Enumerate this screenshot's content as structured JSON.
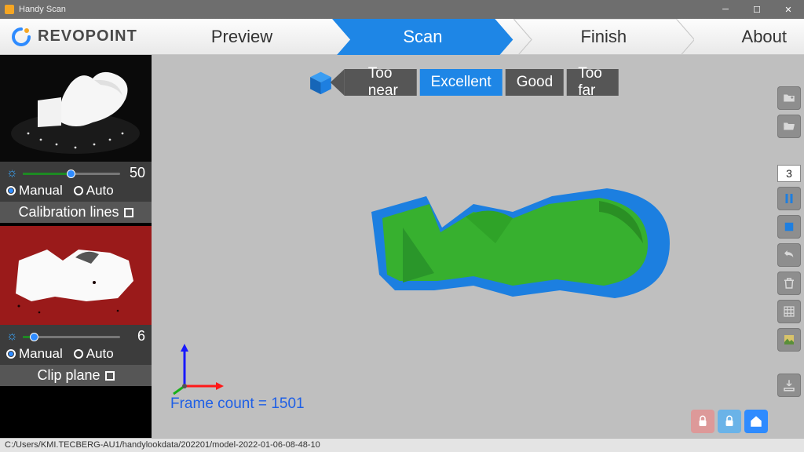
{
  "window": {
    "title": "Handy Scan"
  },
  "brand": {
    "name": "REVOPOINT"
  },
  "nav": {
    "preview": "Preview",
    "scan": "Scan",
    "finish": "Finish",
    "about": "About",
    "active": "scan"
  },
  "distance": {
    "segments": [
      "Too near",
      "Excellent",
      "Good",
      "Too far"
    ],
    "active_index": 1
  },
  "exposure_panel": {
    "value": "50",
    "fill_percent": 50,
    "mode_manual": "Manual",
    "mode_auto": "Auto",
    "selected": "manual",
    "calibration_label": "Calibration lines"
  },
  "depth_panel": {
    "value": "6",
    "fill_percent": 12,
    "mode_manual": "Manual",
    "mode_auto": "Auto",
    "selected": "manual",
    "clip_label": "Clip plane"
  },
  "viewport": {
    "frame_label": "Frame count = ",
    "frame_value": "1501"
  },
  "right_toolbar": {
    "counter": "3"
  },
  "statusbar": {
    "path": "C:/Users/KMI.TECBERG-AU1/handylookdata/202201/model-2022-01-06-08-48-10"
  },
  "colors": {
    "accent": "#1e86e6",
    "model_overlay": "#37b02f",
    "model_base": "#1c7fe0"
  }
}
